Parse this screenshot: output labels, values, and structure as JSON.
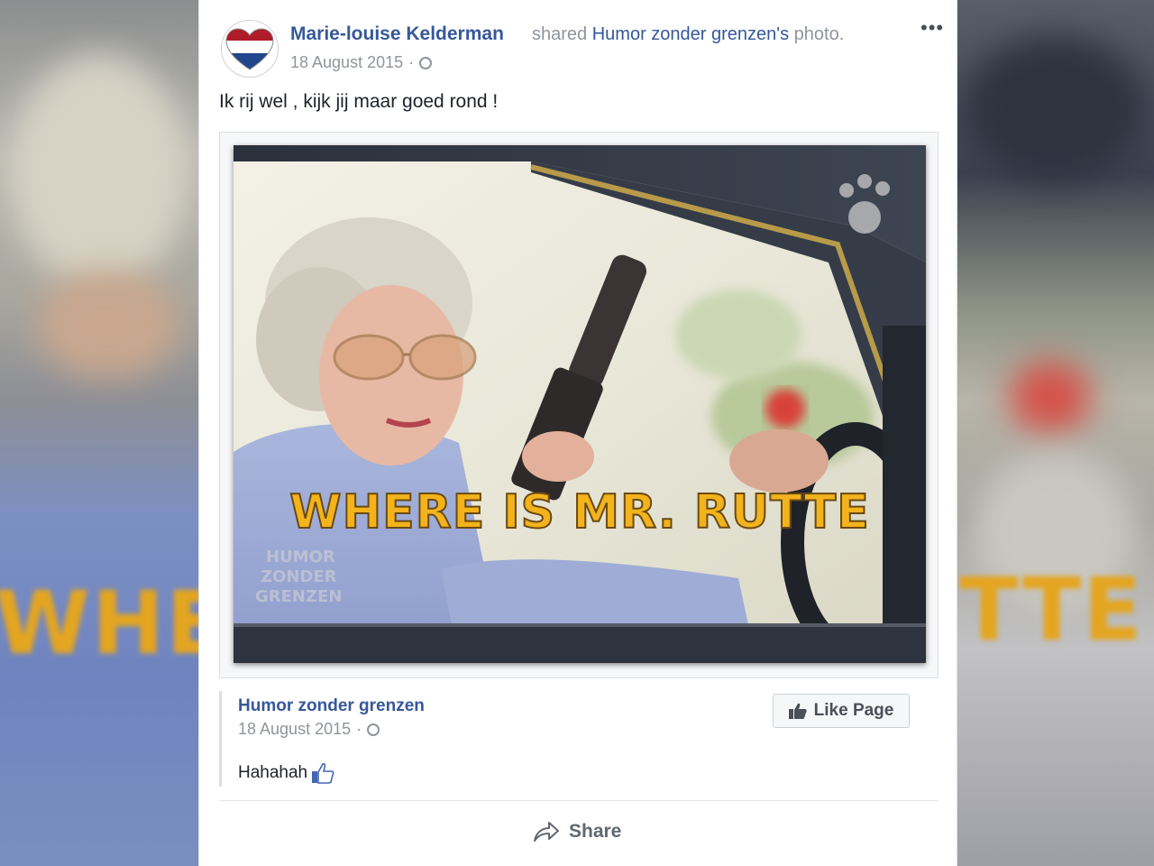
{
  "post": {
    "author": "Marie-louise Kelderman",
    "shared_verb": "shared",
    "shared_page": "Humor zonder grenzen's",
    "shared_object": "photo.",
    "date": "18 August 2015",
    "separator": "·",
    "more_label": "•••",
    "caption": "Ik rij wel , kijk jij maar goed rond !"
  },
  "photo": {
    "overlay_text": "WHERE IS MR. RUTTE",
    "watermark": [
      "HUMOR",
      "ZONDER",
      "GRENZEN"
    ]
  },
  "shared_source": {
    "page_name": "Humor zonder grenzen",
    "date": "18 August 2015",
    "separator": "·",
    "text": "Hahahah",
    "like_page_label": "Like Page"
  },
  "actions": {
    "share_label": "Share"
  },
  "backdrop": {
    "left_text": "WHE",
    "right_text": "TTE"
  },
  "colors": {
    "link": "#365899",
    "meta": "#90949c",
    "overlay_text": "#f2b31c",
    "flag_red": "#ae1c28",
    "flag_blue": "#21468b"
  },
  "icons": {
    "privacy": "globe-icon",
    "like": "thumbs-up-icon",
    "share": "share-arrow-icon"
  }
}
